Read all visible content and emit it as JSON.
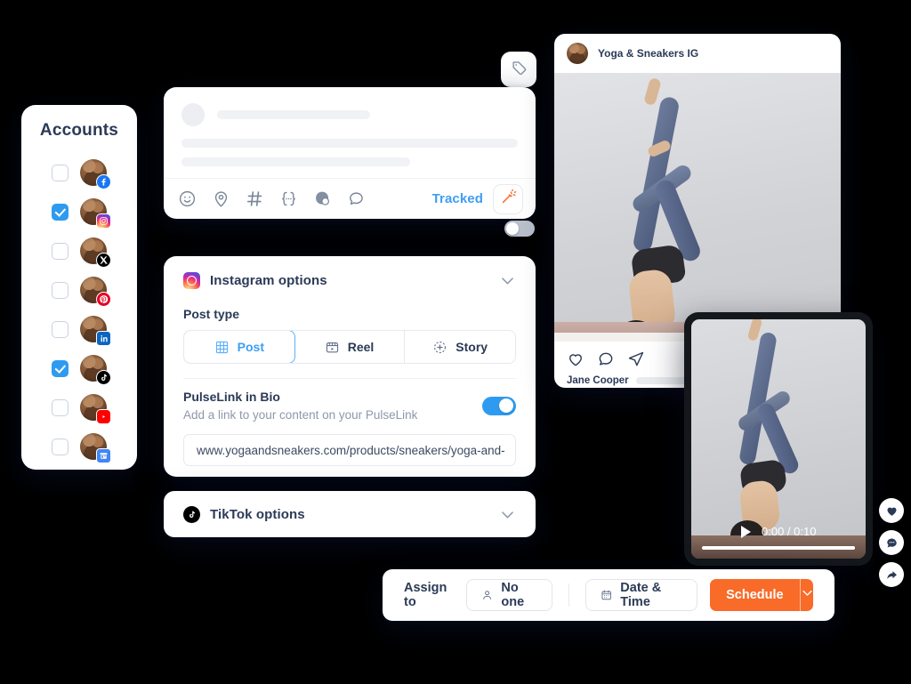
{
  "accounts": {
    "title": "Accounts",
    "items": [
      {
        "network": "facebook",
        "icon": "facebook-icon",
        "checked": false
      },
      {
        "network": "instagram",
        "icon": "instagram-icon",
        "checked": true
      },
      {
        "network": "x",
        "icon": "x-twitter-icon",
        "checked": false
      },
      {
        "network": "pinterest",
        "icon": "pinterest-icon",
        "checked": false
      },
      {
        "network": "linkedin",
        "icon": "linkedin-icon",
        "checked": false
      },
      {
        "network": "tiktok",
        "icon": "tiktok-icon",
        "checked": true
      },
      {
        "network": "youtube",
        "icon": "youtube-icon",
        "checked": false
      },
      {
        "network": "gbp",
        "icon": "google-business-icon",
        "checked": false
      }
    ]
  },
  "composer": {
    "tag_button_icon": "tag-icon",
    "toolbar_icons": [
      "emoji-icon",
      "location-icon",
      "hashtag-icon",
      "variable-icon",
      "globe-icon",
      "comment-icon"
    ],
    "tracked_label": "Tracked",
    "tracked_state": "on",
    "ai_button_icon": "magic-wand-icon",
    "toggle_state": "off"
  },
  "instagram_options": {
    "title": "Instagram options",
    "icon": "instagram-icon",
    "collapse_icon": "chevron-down-icon",
    "post_type_label": "Post type",
    "post_types": [
      {
        "label": "Post",
        "icon": "grid-icon",
        "selected": true
      },
      {
        "label": "Reel",
        "icon": "film-icon",
        "selected": false
      },
      {
        "label": "Story",
        "icon": "story-plus-icon",
        "selected": false
      }
    ],
    "pulselink": {
      "title": "PulseLink in Bio",
      "subtitle": "Add a link to your content on your PulseLink",
      "toggle_state": "on",
      "url": "www.yogaandsneakers.com/products/sneakers/yoga-and-"
    }
  },
  "tiktok_options": {
    "title": "TikTok options",
    "icon": "tiktok-icon",
    "collapse_icon": "chevron-down-icon"
  },
  "instagram_preview": {
    "handle": "Yoga & Sneakers IG",
    "avatar": "account-avatar",
    "actions": [
      "heart-icon",
      "comment-icon",
      "share-icon"
    ],
    "caption_author": "Jane Cooper"
  },
  "video_preview": {
    "play_icon": "play-icon",
    "time": "0:00 / 0:10",
    "current_time": "0:00",
    "duration": "0:10"
  },
  "floating_actions": [
    {
      "icon": "heart-filled-icon"
    },
    {
      "icon": "comment-filled-icon"
    },
    {
      "icon": "share-filled-icon"
    }
  ],
  "action_bar": {
    "assign_label": "Assign to",
    "assignee": "No one",
    "assignee_icon": "person-icon",
    "date_time_label": "Date & Time",
    "date_time_icon": "calendar-icon",
    "schedule_label": "Schedule",
    "schedule_caret_icon": "chevron-down-icon"
  },
  "colors": {
    "accent_blue": "#2e9bf0",
    "accent_orange": "#f96b28",
    "text_dark": "#2b3a57",
    "text_muted": "#8d98ab"
  }
}
